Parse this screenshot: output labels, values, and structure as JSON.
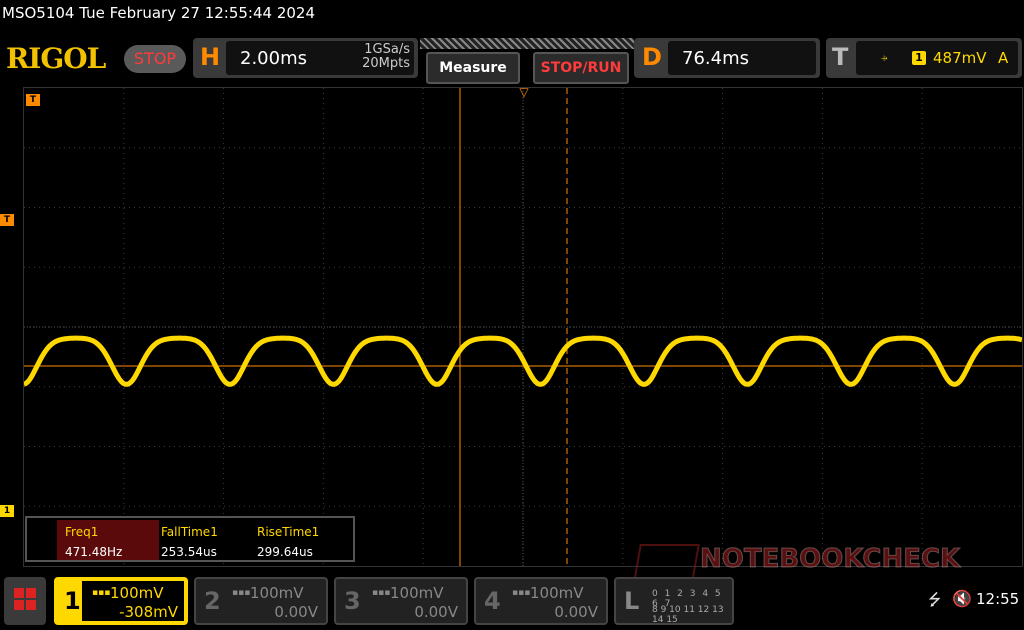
{
  "status_line": "MSO5104  Tue February 27 12:55:44 2024",
  "brand": {
    "logo": "RIGOL",
    "run_state": "STOP"
  },
  "horizontal": {
    "letter": "H",
    "timebase": "2.00ms",
    "sample_rate": "1GSa/s",
    "memory_depth": "20Mpts"
  },
  "buttons": {
    "measure": "Measure",
    "stop_run": "STOP/RUN"
  },
  "delay": {
    "letter": "D",
    "value": "76.4ms"
  },
  "trigger": {
    "letter": "T",
    "edge_icon": "rising-edge-icon",
    "edge_glyph": "⍆",
    "source": "1",
    "level": "487mV",
    "mode": "A"
  },
  "markers": {
    "trigger_top": "T",
    "trigger_level": "T",
    "ch1_ground": "1",
    "trigger_position": "▽"
  },
  "measurements": [
    {
      "name": "Freq1",
      "value": "471.48Hz"
    },
    {
      "name": "FallTime1",
      "value": "253.54us"
    },
    {
      "name": "RiseTime1",
      "value": "299.64us"
    }
  ],
  "channels": [
    {
      "num": "1",
      "coupling": "▪▪▪",
      "scale": "100mV",
      "offset": "-308mV",
      "active": true
    },
    {
      "num": "2",
      "coupling": "▪▪▪",
      "scale": "100mV",
      "offset": "0.00V",
      "active": false
    },
    {
      "num": "3",
      "coupling": "▪▪▪",
      "scale": "100mV",
      "offset": "0.00V",
      "active": false
    },
    {
      "num": "4",
      "coupling": "▪▪▪",
      "scale": "100mV",
      "offset": "0.00V",
      "active": false
    }
  ],
  "logic": {
    "letter": "L",
    "bits_low": "0 1 2 3 4 5 6 7",
    "bits_high": "8 9 10 11 12 13 14 15"
  },
  "tray": {
    "usb_icon": "usb-icon",
    "speaker_icon": "speaker-muted-icon",
    "time": "12:55"
  },
  "watermark": "NOTEBOOKCHECK",
  "waveform": {
    "channel": "1",
    "color": "#ffd800",
    "shape": "periodic pulse dips",
    "frequency_hz": 471.48
  },
  "colors": {
    "accent": "#ff8a00",
    "ch1": "#ffd800",
    "stop": "#ff3b3b",
    "grid": "#444444"
  }
}
